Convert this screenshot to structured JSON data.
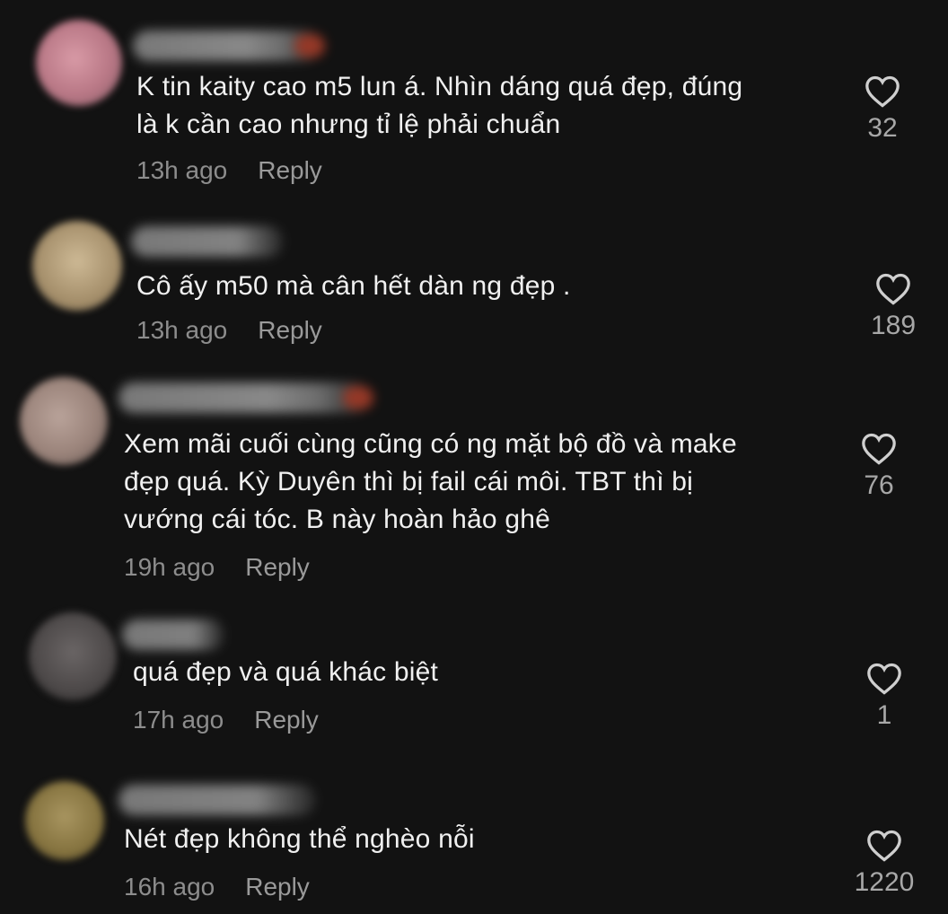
{
  "comments": [
    {
      "text": "K tin kaity cao m5 lun á. Nhìn dáng quá đẹp, đúng\nlà k cần cao nhưng tỉ lệ phải chuẩn",
      "time": "13h ago",
      "reply": "Reply",
      "likes": "32",
      "avatar_color": "#c98593"
    },
    {
      "text": "Cô ấy m50 mà cân hết dàn ng đẹp .",
      "time": "13h ago",
      "reply": "Reply",
      "likes": "189",
      "avatar_color": "#b8a47f"
    },
    {
      "text": "Xem mãi cuối cùng cũng có ng mặt bộ đồ và make\nđẹp quá. Kỳ Duyên thì bị fail cái môi. TBT thì bị\nvướng cái tóc. B này hoàn hảo ghê",
      "time": "19h ago",
      "reply": "Reply",
      "likes": "76",
      "avatar_color": "#a48f86"
    },
    {
      "text": "quá đẹp và quá khác biệt",
      "time": "17h ago",
      "reply": "Reply",
      "likes": "1",
      "avatar_color": "#5a5757"
    },
    {
      "text": "Nét đẹp không thể nghèo nỗi",
      "time": "16h ago",
      "reply": "Reply",
      "likes": "1220",
      "avatar_color": "#8a7a4c"
    }
  ]
}
